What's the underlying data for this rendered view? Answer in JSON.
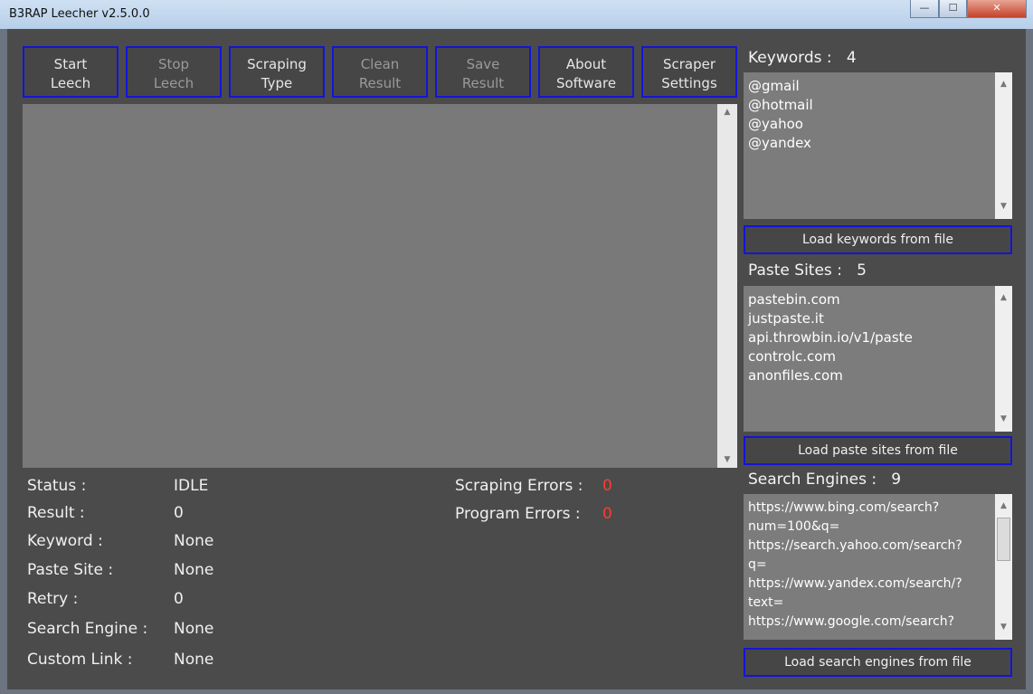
{
  "window": {
    "title": "B3RAP Leecher v2.5.0.0",
    "minimize": "—",
    "maximize": "☐",
    "close": "✕"
  },
  "toolbar": [
    {
      "label": "Start\nLeech",
      "enabled": true
    },
    {
      "label": "Stop\nLeech",
      "enabled": false
    },
    {
      "label": "Scraping\nType",
      "enabled": true
    },
    {
      "label": "Clean\nResult",
      "enabled": false
    },
    {
      "label": "Save\nResult",
      "enabled": false
    },
    {
      "label": "About\nSoftware",
      "enabled": true
    },
    {
      "label": "Scraper\nSettings",
      "enabled": true
    }
  ],
  "status": {
    "status_label": "Status :",
    "status_value": "IDLE",
    "result_label": "Result :",
    "result_value": "0",
    "keyword_label": "Keyword :",
    "keyword_value": "None",
    "paste_site_label": "Paste Site :",
    "paste_site_value": "None",
    "retry_label": "Retry :",
    "retry_value": "0",
    "search_engine_label": "Search Engine :",
    "search_engine_value": "None",
    "custom_link_label": "Custom Link :",
    "custom_link_value": "None",
    "scraping_errors_label": "Scraping Errors :",
    "scraping_errors_value": "0",
    "program_errors_label": "Program Errors :",
    "program_errors_value": "0"
  },
  "keywords": {
    "label": "Keywords :",
    "count": "4",
    "items": [
      "@gmail",
      "@hotmail",
      "@yahoo",
      "@yandex"
    ],
    "load_button": "Load keywords from file"
  },
  "paste_sites": {
    "label": "Paste Sites :",
    "count": "5",
    "items": [
      "pastebin.com",
      "justpaste.it",
      "api.throwbin.io/v1/paste",
      "controlc.com",
      "anonfiles.com"
    ],
    "load_button": "Load paste sites from file"
  },
  "search_engines": {
    "label": "Search Engines :",
    "count": "9",
    "items": [
      "https://www.bing.com/search?",
      "num=100&q=",
      "https://search.yahoo.com/search?",
      "q=",
      "https://www.yandex.com/search/?",
      "text=",
      "https://www.google.com/search?"
    ],
    "load_button": "Load search engines from file"
  },
  "colors": {
    "button_border": "#1414d8",
    "error_value": "#ff3b30",
    "panel": "#4b4b4b"
  }
}
